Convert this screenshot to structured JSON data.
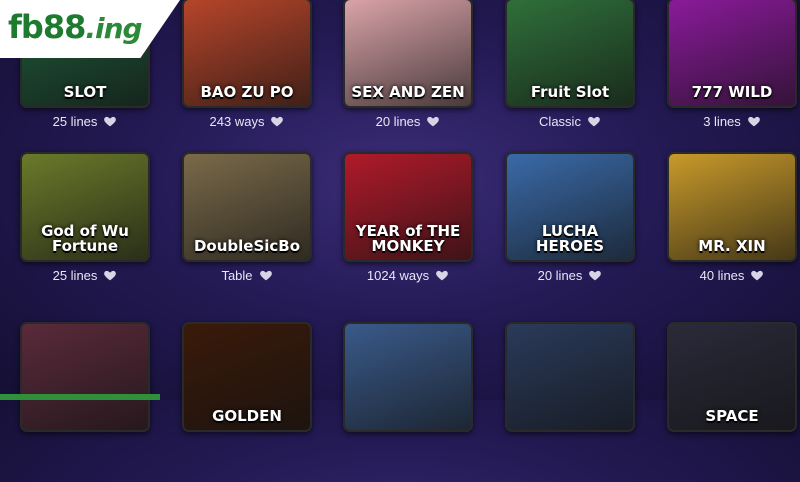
{
  "logo": {
    "part1": "fb88",
    "part2": ".ing"
  },
  "rows": [
    [
      {
        "title": "SLOT",
        "meta": "25 lines",
        "bg": "#1f5a3a"
      },
      {
        "title": "BAO ZU PO",
        "meta": "243 ways",
        "bg": "#b6452a"
      },
      {
        "title": "SEX AND ZEN",
        "meta": "20 lines",
        "bg": "#d9a3a8"
      },
      {
        "title": "Fruit Slot",
        "meta": "Classic",
        "bg": "#2f6f3a"
      },
      {
        "title": "777 WILD",
        "meta": "3 lines",
        "bg": "#8a1a9a"
      }
    ],
    [
      {
        "title": "God of Wu Fortune",
        "meta": "25 lines",
        "bg": "#6a7a2a"
      },
      {
        "title": "DoubleSicBo",
        "meta": "Table",
        "bg": "#7a6a4a"
      },
      {
        "title": "YEAR of THE MONKEY",
        "meta": "1024 ways",
        "bg": "#b01a2a"
      },
      {
        "title": "LUCHA HEROES",
        "meta": "20 lines",
        "bg": "#3a6aa8"
      },
      {
        "title": "MR. XIN",
        "meta": "40 lines",
        "bg": "#c89a2a"
      }
    ],
    [
      {
        "title": "",
        "meta": "",
        "bg": "#5a2a3a"
      },
      {
        "title": "GOLDEN",
        "meta": "",
        "bg": "#3a1a0a"
      },
      {
        "title": "",
        "meta": "",
        "bg": "#3a5a8a"
      },
      {
        "title": "",
        "meta": "",
        "bg": "#2a3a5a"
      },
      {
        "title": "SPACE",
        "meta": "",
        "bg": "#2a2a3a"
      }
    ]
  ],
  "icons": {
    "favorite": "heart-outline-icon"
  }
}
